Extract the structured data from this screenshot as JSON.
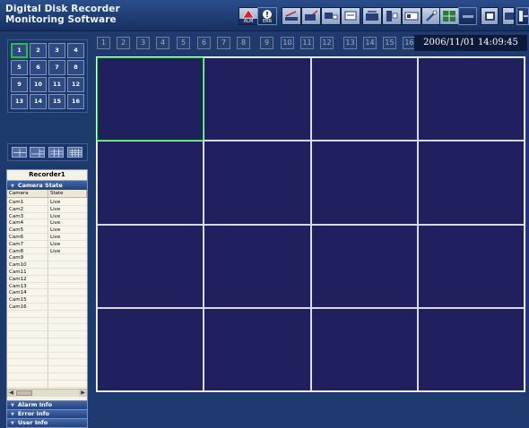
{
  "app": {
    "title": "Digital Disk Recorder\nMonitoring Software"
  },
  "toolbar": {
    "alarm_label": "ALM",
    "error_label": "ERR",
    "buttons": [
      {
        "icon": "alarm-icon",
        "label": "ALM"
      },
      {
        "icon": "error-icon",
        "label": "ERR"
      },
      {
        "icon": "search-icon"
      },
      {
        "icon": "playback-icon"
      },
      {
        "icon": "camera-control-icon"
      },
      {
        "icon": "download-icon"
      },
      {
        "icon": "recorder-icon"
      },
      {
        "icon": "copy-icon"
      },
      {
        "icon": "monitor-icon"
      },
      {
        "icon": "edit-icon"
      },
      {
        "icon": "grid-icon"
      },
      {
        "icon": "settings-icon"
      },
      {
        "icon": "panel-icon"
      },
      {
        "icon": "display-icon"
      },
      {
        "icon": "exit-icon"
      }
    ]
  },
  "camera_strip": {
    "cameras": [
      "1",
      "2",
      "3",
      "4",
      "5",
      "6",
      "7",
      "8",
      "9",
      "10",
      "11",
      "12",
      "13",
      "14",
      "15",
      "16"
    ],
    "datetime": "2006/11/01  14:09:45"
  },
  "split_selector": {
    "cells": [
      "1",
      "2",
      "3",
      "4",
      "5",
      "6",
      "7",
      "8",
      "9",
      "10",
      "11",
      "12",
      "13",
      "14",
      "15",
      "16"
    ],
    "selected": "1"
  },
  "layouts": [
    "quad-layout",
    "six-split-layout",
    "nine-split-layout",
    "sixteen-split-layout"
  ],
  "recorder": {
    "title": "Recorder1",
    "camera_state_label": "Camera State",
    "columns": [
      "Camera",
      "State"
    ],
    "rows": [
      {
        "camera": "Cam1",
        "state": "Live"
      },
      {
        "camera": "Cam2",
        "state": "Live"
      },
      {
        "camera": "Cam3",
        "state": "Live"
      },
      {
        "camera": "Cam4",
        "state": "Live"
      },
      {
        "camera": "Cam5",
        "state": "Live"
      },
      {
        "camera": "Cam6",
        "state": "Live"
      },
      {
        "camera": "Cam7",
        "state": "Live"
      },
      {
        "camera": "Cam8",
        "state": "Live"
      },
      {
        "camera": "Cam9",
        "state": ""
      },
      {
        "camera": "Cam10",
        "state": ""
      },
      {
        "camera": "Cam11",
        "state": ""
      },
      {
        "camera": "Cam12",
        "state": ""
      },
      {
        "camera": "Cam13",
        "state": ""
      },
      {
        "camera": "Cam14",
        "state": ""
      },
      {
        "camera": "Cam15",
        "state": ""
      },
      {
        "camera": "Cam16",
        "state": ""
      }
    ],
    "alarm_info_label": "Alarm Info",
    "error_info_label": "Error Info",
    "user_info_label": "User Info"
  },
  "video_grid": {
    "rows": 4,
    "cols": 4,
    "selected_cell": 0,
    "background": "#20205e",
    "selected_color": "#38c94e"
  }
}
